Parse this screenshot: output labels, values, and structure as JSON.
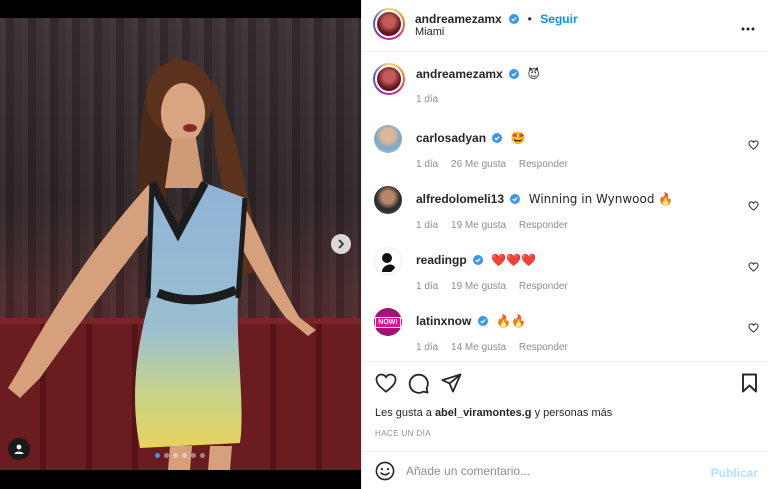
{
  "post": {
    "author": "andreamezamx",
    "follow_label": "Seguir",
    "location": "Miami",
    "caption_emoji": "😈",
    "caption_time": "1 día",
    "image_alt": "",
    "carousel_total": 6,
    "carousel_active": 1
  },
  "comments": [
    {
      "user": "carlosadyan",
      "text": "🤩",
      "time": "1 día",
      "likes": "26 Me gusta",
      "reply": "Responder",
      "verified": true
    },
    {
      "user": "alfredolomeli13",
      "text": "Winning in Wynwood 🔥",
      "time": "1 día",
      "likes": "19 Me gusta",
      "reply": "Responder",
      "verified": true
    },
    {
      "user": "readingp",
      "text": "❤️❤️❤️",
      "time": "1 día",
      "likes": "19 Me gusta",
      "reply": "Responder",
      "verified": true
    },
    {
      "user": "latinxnow",
      "text": "🔥🔥",
      "time": "1 día",
      "likes": "14 Me gusta",
      "reply": "Responder",
      "verified": true
    }
  ],
  "likes_line": {
    "prefix": "Les gusta a",
    "user": "abel_viramontes.g",
    "suffix": "y personas más"
  },
  "time_ago": "HACE UN DÍA",
  "add_comment": {
    "placeholder": "Añade un comentario...",
    "publish_label": "Publicar"
  },
  "latinxnow_logo_text": "NOW!",
  "colors": {
    "accent": "#0095f6",
    "publish_disabled": "#b2dffc",
    "heart_red": "#ed4956",
    "fire": "#f4900c"
  }
}
